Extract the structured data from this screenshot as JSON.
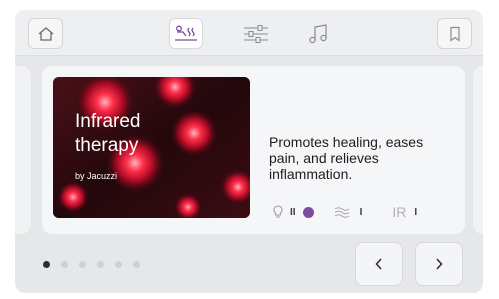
{
  "header": {
    "home_icon": "home-icon",
    "tabs": [
      {
        "icon": "therapy-icon",
        "active": true
      },
      {
        "icon": "settings-sliders-icon",
        "active": false
      },
      {
        "icon": "music-icon",
        "active": false
      }
    ],
    "bookmark_icon": "bookmark-icon"
  },
  "card": {
    "title": "Infrared therapy",
    "subtitle": "by Jacuzzi",
    "description": "Promotes healing, eases pain, and relieves inflammation.",
    "levels": {
      "light_icon": "lightbulb-icon",
      "light_level": "II",
      "active_dot_color": "#7e4a9e",
      "heat_icon": "heat-waves-icon",
      "heat_level": "I",
      "ir_label": "IR",
      "ir_level": "I"
    }
  },
  "pager": {
    "count": 6,
    "active_index": 0
  },
  "nav": {
    "prev_icon": "chevron-left-icon",
    "next_icon": "chevron-right-icon"
  }
}
